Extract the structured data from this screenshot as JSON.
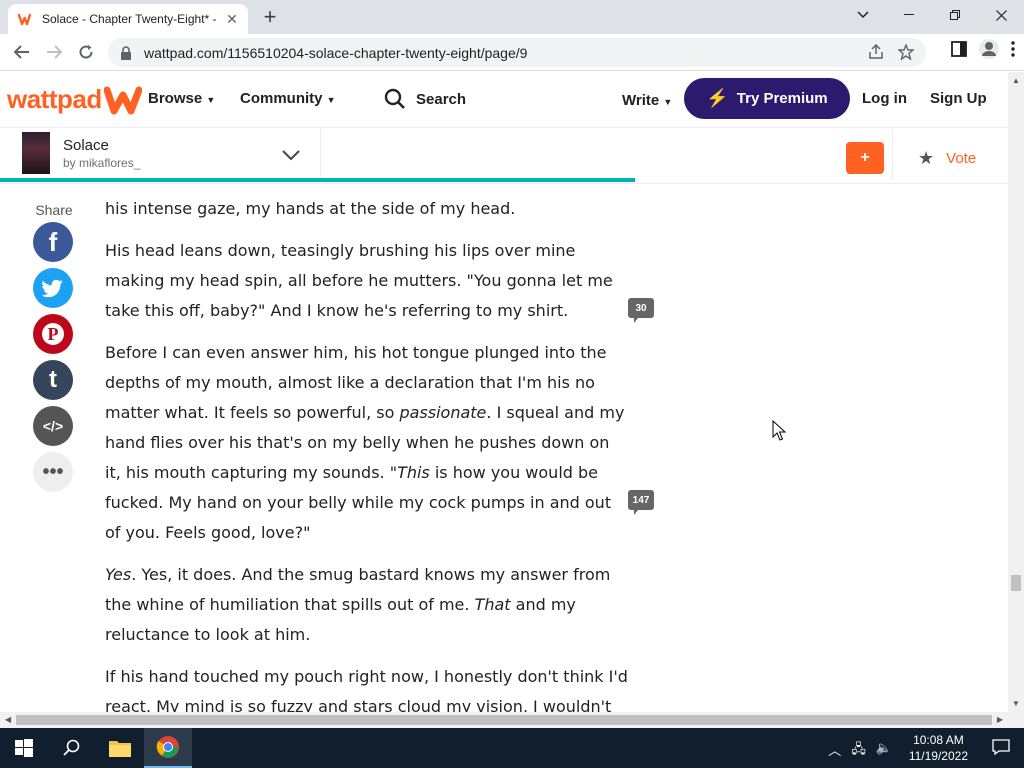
{
  "browser": {
    "tab_title": "Solace - Chapter Twenty-Eight* -",
    "url": "wattpad.com/1156510204-solace-chapter-twenty-eight/page/9"
  },
  "header": {
    "logo": "wattpad",
    "browse": "Browse",
    "community": "Community",
    "search": "Search",
    "write": "Write",
    "premium": "Try Premium",
    "login": "Log in",
    "signup": "Sign Up"
  },
  "story": {
    "title": "Solace",
    "author": "by mikaflores_",
    "add": "+",
    "vote": "Vote",
    "reading_progress_percent": 63
  },
  "share": {
    "label": "Share"
  },
  "paragraphs": [
    {
      "html": "his intense gaze, my hands at the side of my head."
    },
    {
      "html": "His head leans down, teasingly brushing his lips over mine making my head spin, all before he mutters. \"You gonna let me take this off, baby?\" And I know he's referring to my shirt."
    },
    {
      "html": "Before I can even answer him, his hot tongue plunged into the depths of my mouth, almost like a declaration that I'm his no matter what. It feels so powerful, so <em>passionate</em>. I squeal and my hand flies over his that's on my belly when he pushes down on it, his mouth capturing my sounds. \"<em>This</em> is how you would be fucked. My hand on your belly while my cock pumps in and out of you. Feels good, love?\""
    },
    {
      "html": "<em>Yes</em>. Yes, it does. And the smug bastard knows my answer from the whine of humiliation that spills out of me. <em>That</em> and my reluctance to look at him."
    },
    {
      "html": "If his hand touched my pouch right now, I honestly don't think I'd react. My mind is so fuzzy and stars cloud my vision, I wouldn't even notice."
    }
  ],
  "comments": {
    "p2": "30",
    "p3": "147"
  },
  "taskbar": {
    "time": "10:08 AM",
    "date": "11/19/2022"
  }
}
